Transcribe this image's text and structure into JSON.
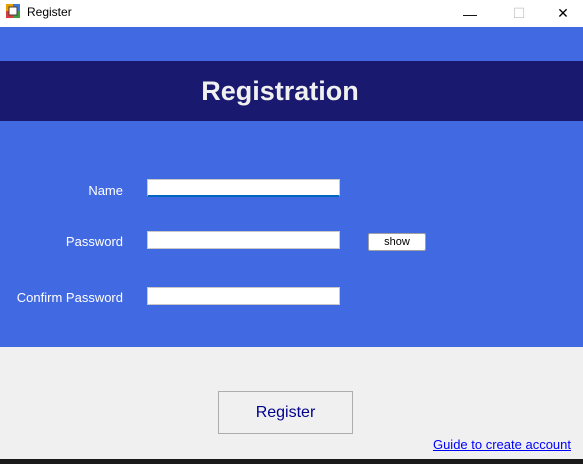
{
  "window": {
    "title": "Register",
    "app_icon": "windows-form-icon",
    "controls": {
      "minimize": "—",
      "maximize": "☐",
      "close": "✕"
    }
  },
  "header": {
    "title": "Registration"
  },
  "form": {
    "name_label": "Name",
    "name_value": "",
    "password_label": "Password",
    "password_value": "",
    "show_button": "show",
    "confirm_label": "Confirm Password",
    "confirm_value": ""
  },
  "actions": {
    "register_button": "Register",
    "guide_link": "Guide to create account"
  },
  "colors": {
    "form_background": "#4169e1",
    "header_band": "#191970",
    "window_background": "#f0f0f0",
    "link": "#0000ff",
    "register_text": "#00008b"
  }
}
